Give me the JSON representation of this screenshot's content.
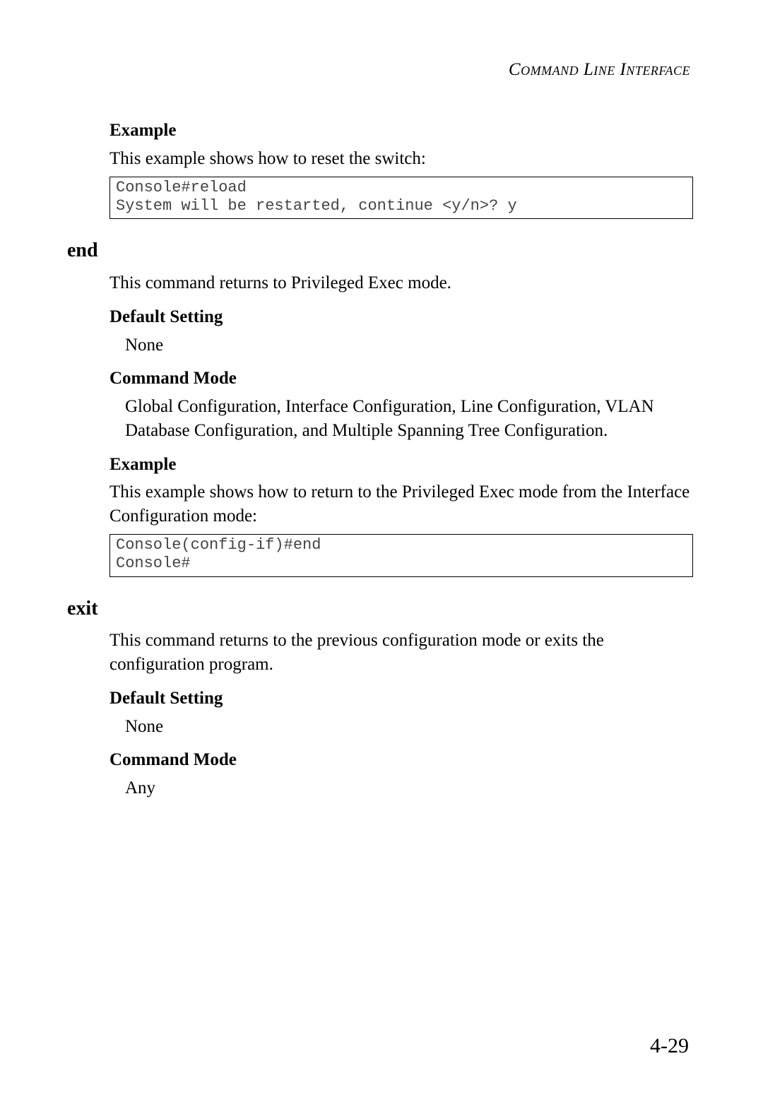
{
  "header": {
    "running_head": "Command Line Interface"
  },
  "section1": {
    "example_label": "Example",
    "example_intro": "This example shows how to reset the switch:",
    "code": "Console#reload\nSystem will be restarted, continue <y/n>? y"
  },
  "end_cmd": {
    "heading": "end",
    "description": "This command returns to Privileged Exec mode.",
    "default_setting_label": "Default Setting",
    "default_setting_value": "None",
    "command_mode_label": "Command Mode",
    "command_mode_value": "Global Configuration, Interface Configuration, Line Configuration, VLAN Database Configuration, and Multiple Spanning Tree Configuration.",
    "example_label": "Example",
    "example_intro": "This example shows how to return to the Privileged Exec mode from the Interface Configuration mode:",
    "code": "Console(config-if)#end\nConsole#"
  },
  "exit_cmd": {
    "heading": "exit",
    "description": "This command returns to the previous configuration mode or exits the configuration program.",
    "default_setting_label": "Default Setting",
    "default_setting_value": "None",
    "command_mode_label": "Command Mode",
    "command_mode_value": "Any"
  },
  "footer": {
    "page_number": "4-29"
  }
}
